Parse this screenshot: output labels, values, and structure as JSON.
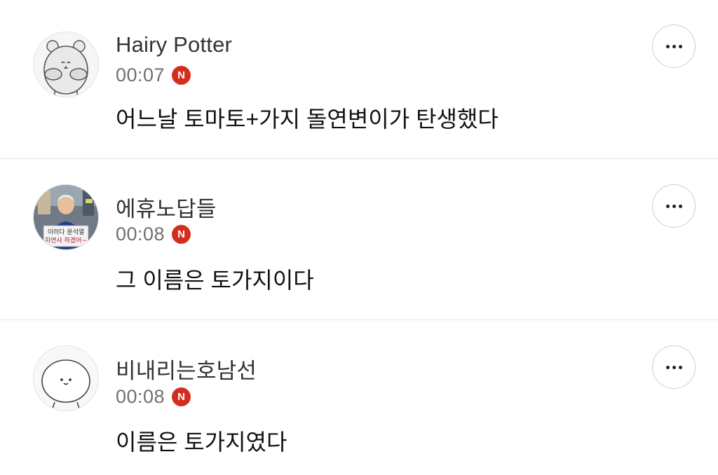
{
  "comments": [
    {
      "author": "Hairy Potter",
      "time": "00:07",
      "badge": "N",
      "text": "어느날 토마토+가지 돌연변이가 탄생했다",
      "avatar_icon": "hamster-character-icon"
    },
    {
      "author": "에휴노답들",
      "time": "00:08",
      "badge": "N",
      "text": "그 이름은 토가지이다",
      "avatar_icon": "photo-avatar",
      "avatar_sign_lines": [
        "이러다 윤석열",
        "자연사 하겠어~"
      ]
    },
    {
      "author": "비내리는호남선",
      "time": "00:08",
      "badge": "N",
      "text": "이름은 토가지였다",
      "avatar_icon": "seal-character-icon"
    }
  ],
  "colors": {
    "badge": "#d32d1f",
    "divider": "#e4e4e4",
    "time": "#707070"
  }
}
